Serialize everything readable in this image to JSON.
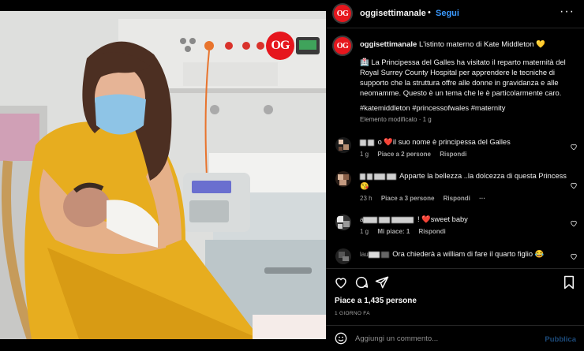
{
  "photo": {
    "alt_logo": "OG",
    "description_icon": "photo-post-image"
  },
  "header": {
    "username": "oggisettimanale",
    "separator": "•",
    "follow_label": "Segui",
    "more_icon": "more-horizontal-icon",
    "avatar_text": "OG"
  },
  "caption": {
    "avatar_text": "OG",
    "username": "oggisettimanale",
    "title": "L'istinto materno di Kate Middleton 💛",
    "body": "🏥 La Principessa del Galles ha visitato il reparto maternità del Royal Surrey County Hospital per apprendere le tecniche di supporto che la struttura offre alle donne in gravidanza e alle neomamme. Questo è un tema che le è particolarmente caro.",
    "tags": "#katemiddleton #princessofwales #maternity",
    "edited": "Elemento modificato · 1 g"
  },
  "comments": [
    {
      "text": "o ❤️il suo nome è principessa del Galles",
      "age": "1 g",
      "likes": "Piace a 2 persone",
      "reply": "Rispondi",
      "more": ""
    },
    {
      "text": "Apparte la bellezza ..la dolcezza di questa Princess😘",
      "age": "23 h",
      "likes": "Piace a 3 persone",
      "reply": "Rispondi",
      "more": "···"
    },
    {
      "text": "! ❤️sweet baby",
      "age": "1 g",
      "likes": "Mi piace: 1",
      "reply": "Rispondi",
      "more": ""
    },
    {
      "text": "Ora chiederà a william di fare il quarto figlio 😂",
      "age": "",
      "likes": "",
      "reply": "",
      "more": ""
    }
  ],
  "actions": {
    "like_icon": "heart-icon",
    "comment_icon": "comment-icon",
    "share_icon": "send-icon",
    "save_icon": "bookmark-icon"
  },
  "likes_count": "Piace a 1,435 persone",
  "date": "1 GIORNO FA",
  "add_comment": {
    "placeholder": "Aggiungi un commento...",
    "publish_label": "Pubblica",
    "emoji_icon": "emoji-icon"
  }
}
